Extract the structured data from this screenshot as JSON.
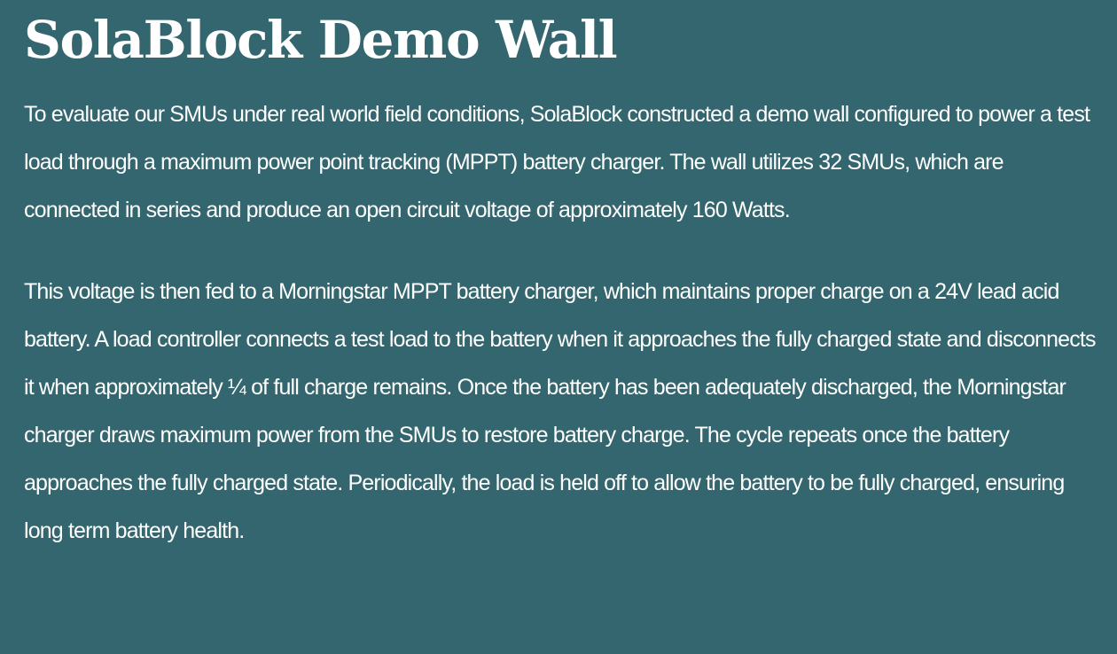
{
  "page": {
    "title": "SolaBlock Demo Wall",
    "paragraphs": [
      "To evaluate our SMUs under real world field conditions, SolaBlock constructed a demo wall configured to power a test load through a maximum power point tracking (MPPT) battery charger. The wall utilizes 32 SMUs, which are connected in series and produce an open circuit voltage of approximately 160 Watts.",
      "This voltage is then fed to a Morningstar MPPT battery charger, which maintains proper charge on a 24V lead acid battery. A load controller connects a test load to the battery when it approaches the fully charged state and disconnects it when approximately ¼ of full charge remains. Once the battery has been adequately discharged, the Morningstar charger draws maximum power from the SMUs to restore battery charge. The cycle repeats once the battery approaches the fully charged state. Periodically, the load is held off to allow the battery to be fully charged, ensuring long term battery health."
    ]
  },
  "colors": {
    "background": "#33666e",
    "text": "#ffffff"
  }
}
